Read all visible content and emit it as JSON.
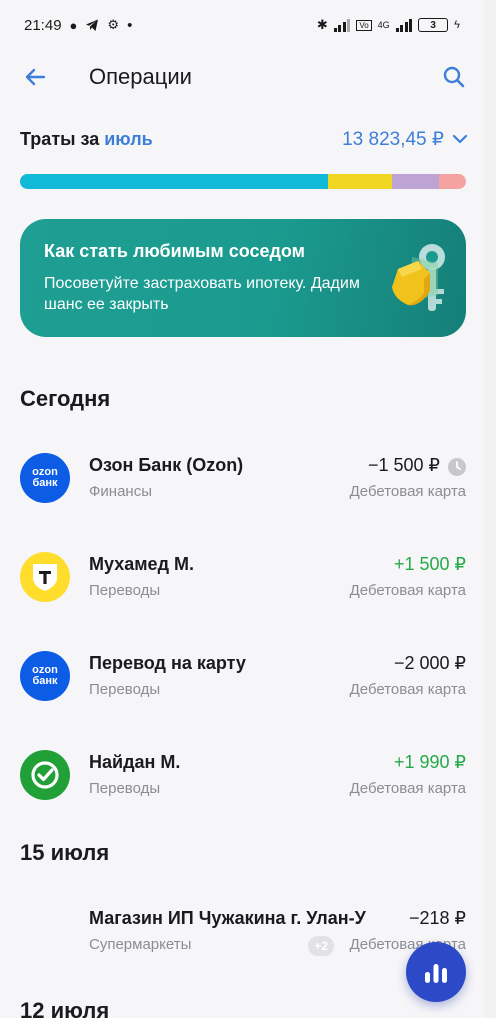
{
  "status_bar": {
    "time": "21:49",
    "network": "4G",
    "battery": "3"
  },
  "header": {
    "title": "Операции"
  },
  "spend": {
    "label": "Траты за",
    "month": "июль",
    "amount": "13 823,45 ₽",
    "segments": [
      {
        "color": "#10b9d8",
        "share": 0.69
      },
      {
        "color": "#f2d722",
        "share": 0.145
      },
      {
        "color": "#bea4d4",
        "share": 0.105
      },
      {
        "color": "#f4a3a1",
        "share": 0.06
      }
    ]
  },
  "promo": {
    "title": "Как стать любимым соседом",
    "text": "Посоветуйте застраховать ипотеку. Дадим шанс ее закрыть"
  },
  "sections": {
    "today": "Сегодня",
    "jul15": "15 июля",
    "jul12": "12 июля"
  },
  "transactions": [
    {
      "name": "Озон Банк (Ozon)",
      "category": "Финансы",
      "amount": "−1 500 ₽",
      "account": "Дебетовая карта",
      "logo_text": "ozon\nбанк"
    },
    {
      "name": "Мухамед М.",
      "category": "Переводы",
      "amount": "+1 500 ₽",
      "account": "Дебетовая карта"
    },
    {
      "name": "Перевод на карту",
      "category": "Переводы",
      "amount": "−2 000 ₽",
      "account": "Дебетовая карта",
      "logo_text": "ozon\nбанк"
    },
    {
      "name": "Найдан М.",
      "category": "Переводы",
      "amount": "+1 990 ₽",
      "account": "Дебетовая карта"
    },
    {
      "name": "Магазин ИП Чужакина г. Улан-У",
      "category": "Супермаркеты",
      "amount": "−218 ₽",
      "account": "Дебетовая карта",
      "badge": "+2"
    }
  ],
  "colors": {
    "accent": "#3d7fd8",
    "positive": "#27a94a",
    "promo": "#1b9b8f",
    "fab": "#2c49c7"
  }
}
